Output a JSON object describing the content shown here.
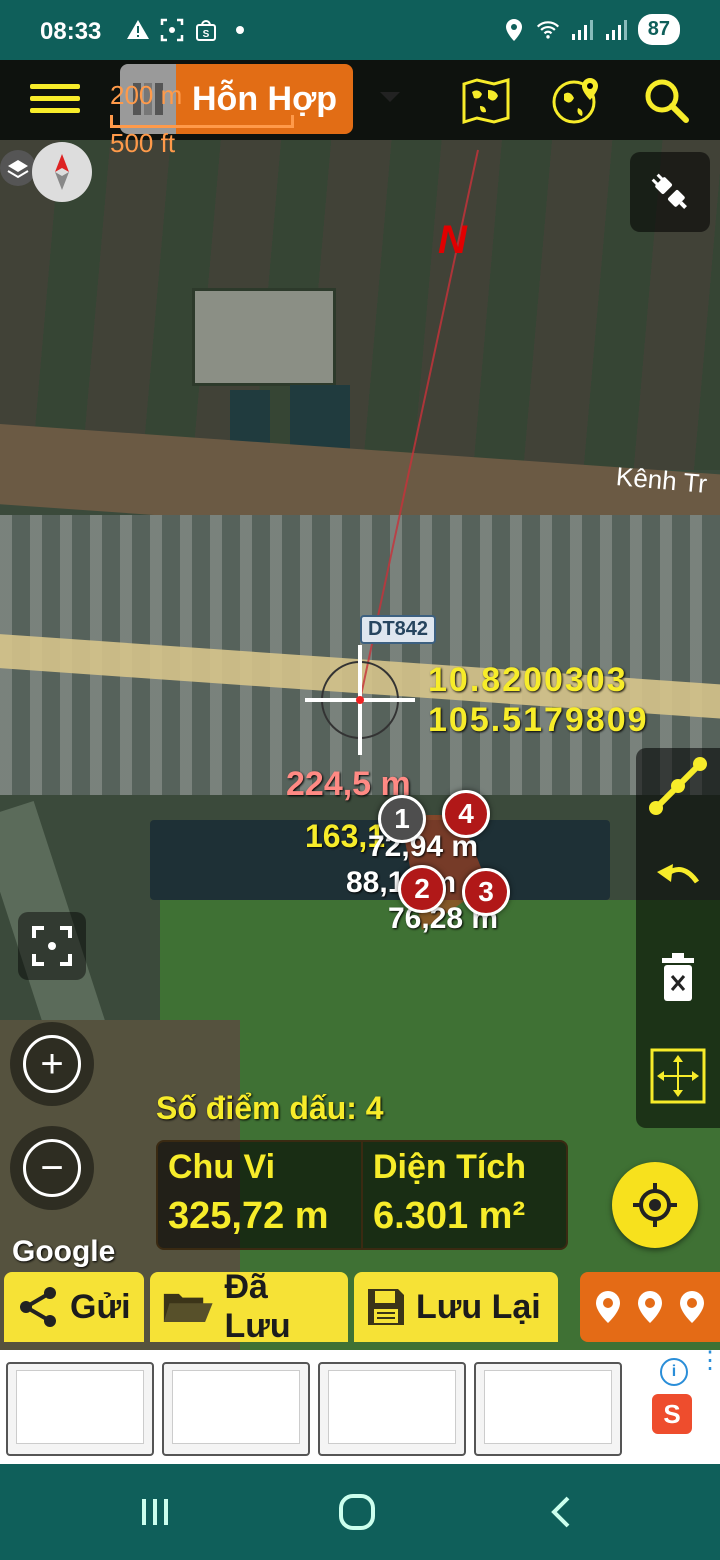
{
  "status_bar": {
    "time": "08:33",
    "battery": "87",
    "icons": [
      "alert-icon",
      "screenshot-icon",
      "shop-icon",
      "dot-icon",
      "location-icon",
      "wifi-icon",
      "signal-icon",
      "signal2-icon"
    ]
  },
  "toolbar": {
    "map_type": "Hỗn Hợp",
    "icons": [
      "menu-icon",
      "world-map-icon",
      "globe-pin-icon",
      "search-icon"
    ]
  },
  "scale": {
    "metric": "200 m",
    "imperial": "500 ft"
  },
  "map": {
    "north_label": "N",
    "road_label": "DT842",
    "place_label": "Kênh Tr",
    "coordinates": {
      "lat": "10.8200303",
      "lng": "105.5179809"
    },
    "distance_to_center": "224,5 m",
    "bearing": "163,1°",
    "edge_lengths": [
      "72,94 m",
      "88,13 m",
      "76,28 m"
    ],
    "markers": [
      "1",
      "2",
      "3",
      "4"
    ],
    "attribution": "Google"
  },
  "measurement": {
    "marks_label": "Số điểm dấu:",
    "marks_count": "4",
    "perimeter_label": "Chu Vi",
    "perimeter_value": "325,72 m",
    "area_label": "Diện Tích",
    "area_value": "6.301 m²"
  },
  "bottom_buttons": {
    "send": "Gửi",
    "saved": "Đã Lưu",
    "save": "Lưu Lại"
  },
  "colors": {
    "accent_yellow": "#f7ec2a",
    "orange": "#e26d15",
    "status_teal": "#0f5f5a",
    "marker_red": "#b11818",
    "measure_red": "#ff8a84"
  }
}
